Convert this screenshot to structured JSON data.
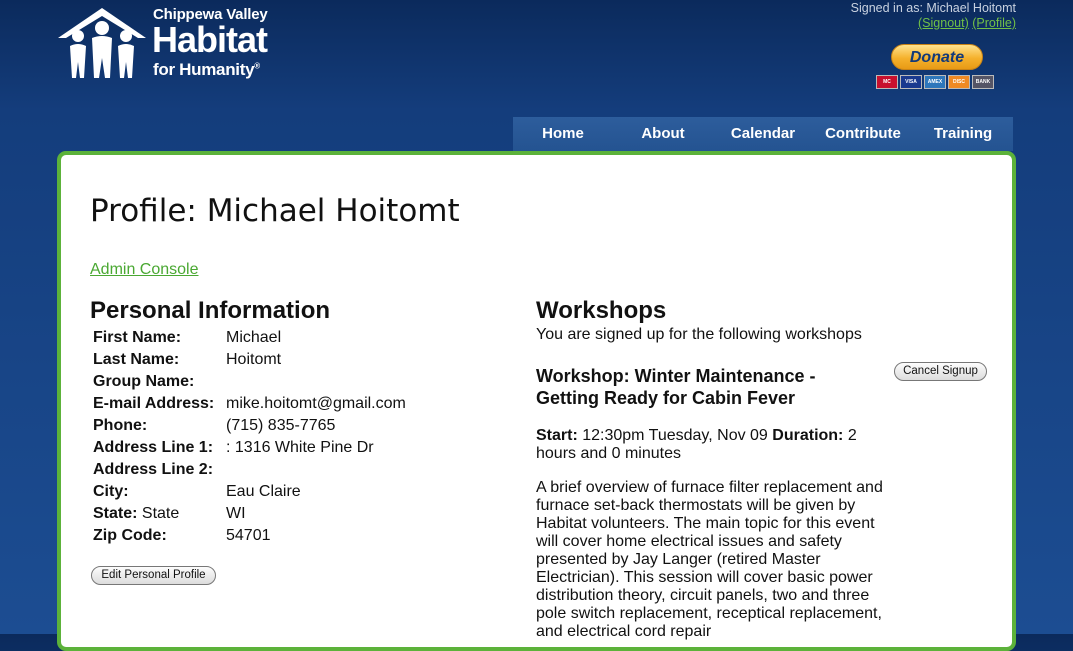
{
  "header": {
    "org_line1": "Chippewa Valley",
    "org_line2": "Habitat",
    "org_line3": "for Humanity",
    "registered": "®",
    "signed_in_text": "Signed in as: Michael Hoitomt",
    "signout_link": "(Signout)",
    "profile_link": "(Profile)",
    "donate_label": "Donate",
    "cards": [
      "MC",
      "VISA",
      "AMEX",
      "DISC",
      "BANK"
    ]
  },
  "nav": {
    "items": [
      "Home",
      "About",
      "Calendar",
      "Contribute",
      "Training"
    ]
  },
  "page": {
    "title": "Profile: Michael Hoitomt",
    "admin_link": "Admin Console"
  },
  "personal": {
    "heading": "Personal Information",
    "rows": [
      {
        "label": "First Name:",
        "value": "Michael"
      },
      {
        "label": "Last Name:",
        "value": "Hoitomt"
      },
      {
        "label": "Group Name:",
        "value": ""
      },
      {
        "label": "E-mail Address:",
        "value": "mike.hoitomt@gmail.com"
      },
      {
        "label": "Phone:",
        "value": "(715) 835-7765"
      },
      {
        "label": "Address Line 1:",
        "value": ": 1316 White Pine Dr"
      },
      {
        "label": "Address Line 2:",
        "value": ""
      },
      {
        "label": "City:",
        "value": "Eau Claire"
      },
      {
        "label": "State:",
        "label_extra": " State",
        "value": "WI"
      },
      {
        "label": "Zip Code:",
        "value": "54701"
      }
    ],
    "edit_button": "Edit Personal Profile"
  },
  "workshops": {
    "heading": "Workshops",
    "subtitle": "You are signed up for the following workshops",
    "cancel_button": "Cancel Signup",
    "item": {
      "title": "Workshop: Winter Maintenance - Getting Ready for Cabin Fever",
      "start_label": "Start:",
      "start_value": "12:30pm Tuesday, Nov 09",
      "duration_label": "Duration:",
      "duration_value": "2 hours and 0 minutes",
      "description": "A brief overview of furnace filter replacement and furnace set-back thermostats will be given by Habitat volunteers. The main topic for this event will cover home electrical issues and safety presented by Jay Langer (retired Master Electrician). This session will cover basic power distribution theory, circuit panels, two and three pole switch replacement, receptical replacement, and electrical cord repair"
    }
  },
  "colors": {
    "accent_green": "#5cb23a",
    "header_blue": "#143d7c",
    "donate_orange": "#f5b12c"
  }
}
